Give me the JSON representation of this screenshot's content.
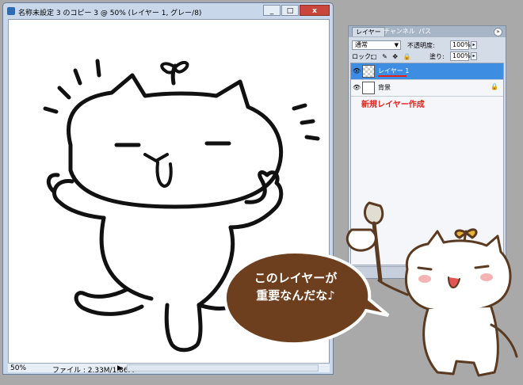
{
  "document": {
    "title": "名称未設定 3 のコピー 3 @ 50% (レイヤー 1, グレー/8)",
    "buttons": {
      "minimize": "_",
      "maximize": "□",
      "close": "x"
    },
    "status": {
      "zoom": "50%",
      "file_info": "ファイル : 2.33M/1.86M",
      "arrow": "▶"
    }
  },
  "layers_panel": {
    "tabs": [
      "レイヤー",
      "チャンネル",
      "パス"
    ],
    "menu_icon": "»",
    "blend_mode": "通常",
    "opacity_label": "不透明度:",
    "opacity_value": "100%",
    "lock_label": "ロック:",
    "lock_icons": "□ ✎ ✥ 🔒",
    "fill_label": "塗り:",
    "fill_value": "100%",
    "layers": [
      {
        "name": "レイヤー 1",
        "selected": true,
        "eye": "👁"
      },
      {
        "name": "背景",
        "selected": false,
        "eye": "👁",
        "lock": "🔒"
      }
    ],
    "annotation": "新規レイヤー作成"
  },
  "bubble": {
    "line1": "このレイヤーが",
    "line2": "重要なんだな♪"
  },
  "colors": {
    "accent_red": "#e2231a",
    "selection_blue": "#3d8de3",
    "bubble_brown": "#6e3f1f"
  }
}
